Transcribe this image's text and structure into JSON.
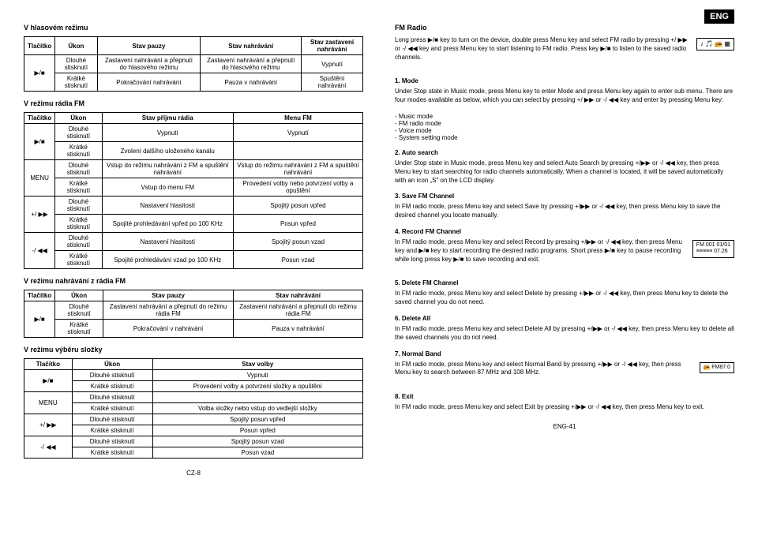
{
  "badge": "ENG",
  "left": {
    "s1": "V hlasovém režimu",
    "t1": {
      "h": [
        "Tlačítko",
        "Úkon",
        "Stav pauzy",
        "Stav nahrávání",
        "Stav zastavení nahrávání"
      ],
      "r1": [
        "▶/■",
        "Dlouhé stisknutí",
        "Zastavení nahrávání a přepnutí do hlasového režimu",
        "Zastavení nahrávání a přepnutí do hlasového režimu",
        "Vypnutí"
      ],
      "r2": [
        "Krátké stisknutí",
        "Pokračování nahrávání",
        "Pauza v nahrávání",
        "Spuštění nahrávání"
      ]
    },
    "s2": "V režimu rádia FM",
    "t2": {
      "h": [
        "Tlačítko",
        "Úkon",
        "Stav příjmu rádia",
        "Menu FM"
      ],
      "r1": [
        "▶/■",
        "Dlouhé stisknutí",
        "Vypnutí",
        "Vypnutí"
      ],
      "r2": [
        "Krátké stisknutí",
        "Zvolení dalšího uloženého kanálu",
        ""
      ],
      "r3": [
        "MENU",
        "Dlouhé stisknutí",
        "Vstup do režimu nahrávání z FM a spuštění nahrávání",
        "Vstup do režimu nahrávání z FM a spuštění nahrávání"
      ],
      "r4": [
        "Krátké stisknutí",
        "Vstup do menu FM",
        "Provedení volby nebo potvrzení volby a opuštění"
      ],
      "r5": [
        "+/ ▶▶",
        "Dlouhé stisknutí",
        "Nastavení hlasitosti",
        "Spojitý posun vpřed"
      ],
      "r6": [
        "Krátké stisknutí",
        "Spojité prohledávání vpřed po 100 KHz",
        "Posun vpřed"
      ],
      "r7": [
        "-/ ◀◀",
        "Dlouhé stisknutí",
        "Nastavení hlasitosti",
        "Spojitý posun vzad"
      ],
      "r8": [
        "Krátké stisknutí",
        "Spojité prohledávání vzad po 100 KHz",
        "Posun vzad"
      ]
    },
    "s3": "V režimu nahrávání z rádia FM",
    "t3": {
      "h": [
        "Tlačítko",
        "Úkon",
        "Stav pauzy",
        "Stav nahrávání"
      ],
      "r1": [
        "▶/■",
        "Dlouhé stisknutí",
        "Zastavení nahrávání a přepnutí do režimu rádia FM",
        "Zastavení nahrávání a přepnutí do režimu rádia FM"
      ],
      "r2": [
        "Krátké stisknutí",
        "Pokračování v nahrávání",
        "Pauza v nahrávání"
      ]
    },
    "s4": "V režimu výběru složky",
    "t4": {
      "h": [
        "Tlačítko",
        "Úkon",
        "Stav volby"
      ],
      "r1": [
        "▶/■",
        "Dlouhé stisknutí",
        "Vypnutí"
      ],
      "r2": [
        "Krátké stisknutí",
        "Provedení volby a potvrzení složky a opuštění"
      ],
      "r3": [
        "MENU",
        "Dlouhé stisknutí",
        ""
      ],
      "r4": [
        "Krátké stisknutí",
        "Volba složky nebo vstup do vedlejší složky"
      ],
      "r5": [
        "+/ ▶▶",
        "Dlouhé stisknutí",
        "Spojitý posun vpřed"
      ],
      "r6": [
        "Krátké stisknutí",
        "Posun vpřed"
      ],
      "r7": [
        "-/ ◀◀",
        "Dlouhé stisknutí",
        "Spojitý posun vzad"
      ],
      "r8": [
        "Krátké stisknutí",
        "Posun vzad"
      ]
    },
    "page": "CZ-8"
  },
  "right": {
    "title": "FM Radio",
    "intro": "Long press ▶/■ key to turn on the device, double press Menu key and select FM radio by pressing +/ ▶▶ or -/ ◀◀ key and press Menu key to start listening to FM radio. Press key ▶/■ to listen to the saved radio channels.",
    "h1": "1. Mode",
    "p1": "Under Stop state in Music mode, press Menu key to enter Mode and press Menu key again to enter sub menu. There are four modes available as below, which you can select by pressing +/ ▶▶ or -/ ◀◀ key and enter by pressing Menu key:",
    "modes": [
      "Music mode",
      "FM radio mode",
      "Voice mode",
      "System setting mode"
    ],
    "h2": "2. Auto search",
    "p2": "Under Stop state in Music mode, press Menu key and select Auto Search by pressing +/▶▶ or -/ ◀◀ key, then press Menu key to start searching for radio channels automatically. When a channel is located, it will be saved automatically with an icon „S\" on the LCD display.",
    "h3": "3. Save FM Channel",
    "p3": "In FM radio mode, press Menu key and select Save by pressing +/▶▶ or -/ ◀◀ key, then press Menu key to save the desired channel you locate manually.",
    "h4": "4. Record FM Channel",
    "p4": "In FM radio mode, press Menu key and select Record by pressing +/▶▶ or -/ ◀◀ key, then press Menu key and ▶/■ key to start recording the desired radio programs. Short press ▶/■ key to pause recording while long press key ▶/■ to save recording and exit.",
    "h5": "5. Delete FM Channel",
    "p5": "In FM radio mode, press Menu key and select Delete by pressing +/▶▶ or -/ ◀◀ key, then press Menu key to delete the saved channel you do not need.",
    "h6": "6. Delete All",
    "p6": "In FM radio mode, press Menu key and select Delete All by pressing +/▶▶ or -/ ◀◀ key, then press Menu key to delete all the saved channels you do not need.",
    "h7": "7. Normal Band",
    "p7": "In FM radio mode, press Menu key and select Normal Band by pressing +/▶▶ or -/ ◀◀ key, then press Menu key to search between 87 MHz and 108 MHz.",
    "h8": "8. Exit",
    "p8": "In FM radio mode, press Menu key and select Exit by pressing +/▶▶ or -/ ◀◀ key, then press Menu key to exit.",
    "lcd1_top": "♪ 🎵 📻 ▦",
    "lcd2_l1": "FM 001 01/01",
    "lcd2_l2": "≡≡≡≡≡ 07.26",
    "lcd3": "FM87.0",
    "page": "ENG-41"
  }
}
